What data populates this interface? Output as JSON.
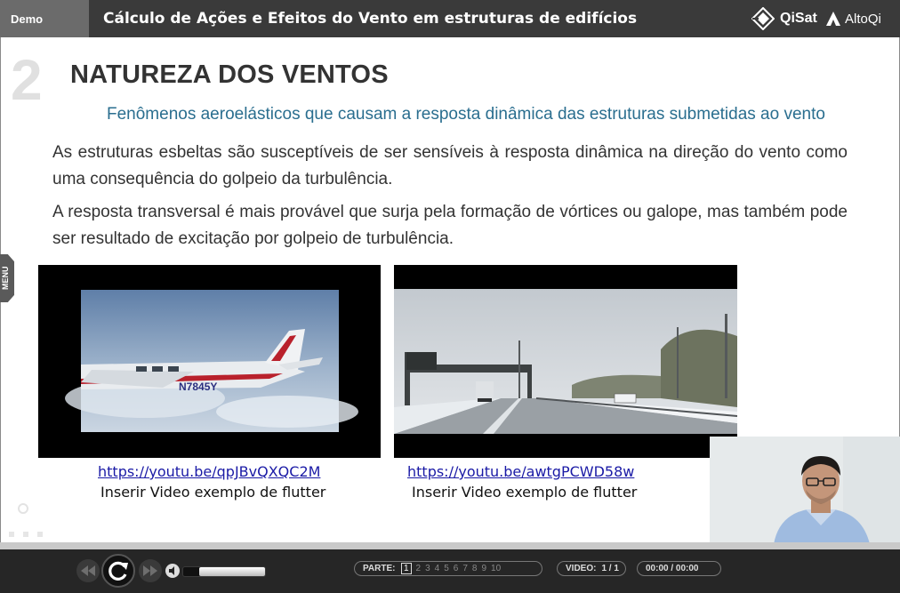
{
  "header": {
    "demo_label": "Demo",
    "course_title": "Cálculo de Ações e Efeitos do Vento em estruturas de edifícios",
    "brand_qisat": "QiSat",
    "brand_altoqi": "AltoQi"
  },
  "sidebar": {
    "menu_label": "MENU"
  },
  "slide": {
    "number": "2",
    "title": "NATUREZA DOS VENTOS",
    "subtitle": "Fenômenos aeroelásticos que causam a resposta dinâmica das estruturas submetidas  ao vento",
    "paragraph1": "As estruturas esbeltas são susceptíveis de ser sensíveis à resposta dinâmica na direção do vento como uma consequência do golpeio da turbulência.",
    "paragraph2": "A resposta transversal é mais provável que surja pela formação de vórtices ou galope, mas também pode ser resultado de excitação por golpeio de turbulência."
  },
  "videos": [
    {
      "plane_text": "N7845Y",
      "link": "https://youtu.be/qpJBvQXQC2M",
      "caption": "Inserir Video exemplo de flutter"
    },
    {
      "link": "https://youtu.be/awtgPCWD58w",
      "caption": "Inserir Video exemplo de flutter"
    }
  ],
  "player": {
    "part_label": "PARTE:",
    "parts": [
      "1",
      "2",
      "3",
      "4",
      "5",
      "6",
      "7",
      "8",
      "9",
      "10"
    ],
    "current_part": "1",
    "video_label": "VIDEO:",
    "video_value": "1 / 1",
    "time": "00:00 / 00:00",
    "volume_level": 0.8
  },
  "colors": {
    "topbar": "#3a3a3a",
    "subtitle": "#2a6e8f",
    "link": "#1a1aa6",
    "controlbar": "#262626"
  }
}
